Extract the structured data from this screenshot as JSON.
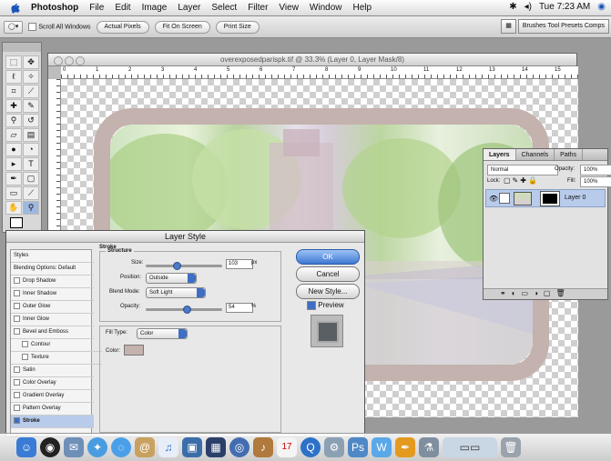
{
  "menubar": {
    "app_name": "Photoshop",
    "menus": [
      "File",
      "Edit",
      "Image",
      "Layer",
      "Select",
      "Filter",
      "View",
      "Window",
      "Help"
    ],
    "clock": "Tue 7:23 AM"
  },
  "options_bar": {
    "scroll_all_windows": "Scroll All Windows",
    "actual_pixels": "Actual Pixels",
    "fit_on_screen": "Fit On Screen",
    "print_size": "Print Size",
    "wells": "Brushes  Tool Presets  Comps"
  },
  "document": {
    "title": "overexposedparispk.tif @ 33.3% (Layer 0, Layer Mask/8)",
    "ruler_labels": [
      "0",
      "1",
      "2",
      "3",
      "4",
      "5",
      "6",
      "7",
      "8",
      "9",
      "10",
      "11",
      "12",
      "13",
      "14",
      "15"
    ]
  },
  "layers_palette": {
    "tabs": [
      "Layers",
      "Channels",
      "Paths"
    ],
    "blend_mode": "Normal",
    "opacity_label": "Opacity:",
    "opacity_value": "100%",
    "lock_label": "Lock:",
    "fill_label": "Fill:",
    "fill_value": "100%",
    "layer_name": "Layer 0"
  },
  "layer_style": {
    "title": "Layer Style",
    "styles_header": "Styles",
    "blending_options": "Blending Options: Default",
    "effects": [
      {
        "label": "Drop Shadow",
        "checked": false
      },
      {
        "label": "Inner Shadow",
        "checked": false
      },
      {
        "label": "Outer Glow",
        "checked": false
      },
      {
        "label": "Inner Glow",
        "checked": false
      },
      {
        "label": "Bevel and Emboss",
        "checked": false
      },
      {
        "label": "Contour",
        "checked": false
      },
      {
        "label": "Texture",
        "checked": false
      },
      {
        "label": "Satin",
        "checked": false
      },
      {
        "label": "Color Overlay",
        "checked": false
      },
      {
        "label": "Gradient Overlay",
        "checked": false
      },
      {
        "label": "Pattern Overlay",
        "checked": false
      },
      {
        "label": "Stroke",
        "checked": true
      }
    ],
    "stroke_header": "Stroke",
    "structure_header": "Structure",
    "size_label": "Size:",
    "size_value": "103",
    "size_unit": "px",
    "size_fraction": 0.4,
    "position_label": "Position:",
    "position_value": "Outside",
    "blend_mode_label": "Blend Mode:",
    "blend_mode_value": "Soft Light",
    "opacity_label": "Opacity:",
    "opacity_value": "54",
    "opacity_unit": "%",
    "opacity_fraction": 0.54,
    "fill_type_label": "Fill Type:",
    "fill_type_value": "Color",
    "color_label": "Color:",
    "stroke_color": "#c4b2ae",
    "buttons": {
      "ok": "OK",
      "cancel": "Cancel",
      "new_style": "New Style...",
      "preview": "Preview"
    },
    "preview_checked": true
  },
  "dock": {
    "icons": [
      "finder-icon",
      "dashboard-icon",
      "mail-icon",
      "safari-icon",
      "ichat-icon",
      "address-book-icon",
      "itunes-icon",
      "iphoto-icon",
      "imovie-icon",
      "idvd-icon",
      "garageband-icon",
      "ical-icon",
      "quicktime-icon",
      "preferences-icon",
      "photoshop-icon",
      "bridge-icon",
      "illustrator-icon",
      "stuffit-icon",
      "preview-icon",
      "trash-icon"
    ]
  }
}
